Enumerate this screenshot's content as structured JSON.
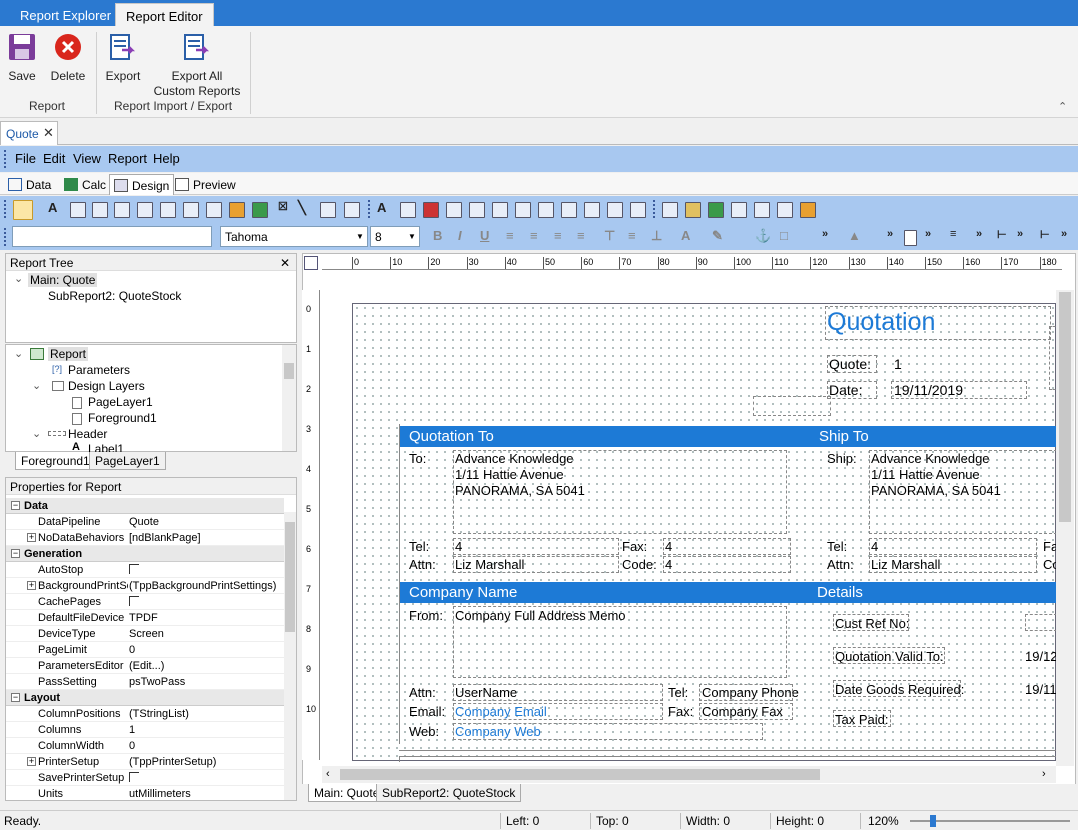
{
  "ribbon": {
    "tabs": [
      "Report Explorer",
      "Report Editor"
    ],
    "save": "Save",
    "delete": "Delete",
    "export": "Export",
    "export_all_1": "Export All",
    "export_all_2": "Custom Reports",
    "group_report": "Report",
    "group_import": "Report Import / Export"
  },
  "doc_tab": "Quote",
  "menu": [
    "File",
    "Edit",
    "View",
    "Report",
    "Help"
  ],
  "view_tabs": [
    "Data",
    "Calc",
    "Design",
    "Preview"
  ],
  "font": {
    "name": "Tahoma",
    "size": "8"
  },
  "report_tree": {
    "title": "Report Tree",
    "main": "Main: Quote",
    "sub": "SubReport2: QuoteStock"
  },
  "tree": {
    "report": "Report",
    "parameters": "Parameters",
    "design_layers": "Design Layers",
    "pagelayer": "PageLayer1",
    "foreground": "Foreground1",
    "header": "Header",
    "label": "Label1"
  },
  "layer_tabs": [
    "Foreground1",
    "PageLayer1"
  ],
  "props": {
    "title": "Properties for Report",
    "cat_data": "Data",
    "cat_generation": "Generation",
    "cat_layout": "Layout",
    "rows": [
      {
        "n": "DataPipeline",
        "v": "Quote"
      },
      {
        "n": "NoDataBehaviors",
        "v": "[ndBlankPage]"
      },
      {
        "n": "AutoStop",
        "v": ""
      },
      {
        "n": "BackgroundPrintSe",
        "v": "(TppBackgroundPrintSettings)"
      },
      {
        "n": "CachePages",
        "v": ""
      },
      {
        "n": "DefaultFileDevice",
        "v": "TPDF"
      },
      {
        "n": "DeviceType",
        "v": "Screen"
      },
      {
        "n": "PageLimit",
        "v": "0"
      },
      {
        "n": "ParametersEditor",
        "v": "(Edit...)"
      },
      {
        "n": "PassSetting",
        "v": "psTwoPass"
      },
      {
        "n": "ColumnPositions",
        "v": "(TStringList)"
      },
      {
        "n": "Columns",
        "v": "1"
      },
      {
        "n": "ColumnWidth",
        "v": "0"
      },
      {
        "n": "PrinterSetup",
        "v": "(TppPrinterSetup)"
      },
      {
        "n": "SavePrinterSetup",
        "v": ""
      },
      {
        "n": "Units",
        "v": "utMillimeters"
      }
    ]
  },
  "ruler": [
    "0",
    "10",
    "20",
    "30",
    "40",
    "50",
    "60",
    "70",
    "80",
    "90",
    "100",
    "110",
    "120",
    "130",
    "140",
    "150",
    "160",
    "170",
    "180"
  ],
  "vruler": [
    "0",
    "1",
    "2",
    "3",
    "4",
    "5",
    "6",
    "7",
    "8",
    "9",
    "10"
  ],
  "design": {
    "quotation": "Quotation",
    "quote_lbl": "Quote:",
    "quote_val": "1",
    "date_lbl": "Date:",
    "date_val": "19/11/2019",
    "quotation_to": "Quotation To",
    "ship_to": "Ship To",
    "to": "To:",
    "to_name": "Advance Knowledge",
    "to_addr1": "1/11 Hattie Avenue",
    "to_addr2": "PANORAMA, SA 5041",
    "ship": "Ship:",
    "ship_name": "Advance Knowledge",
    "ship_addr1": "1/11 Hattie Avenue",
    "ship_addr2": "PANORAMA, SA 5041",
    "tel": "Tel:",
    "tel_val": "4",
    "fax": "Fax:",
    "fax_val": "4",
    "attn": "Attn:",
    "attn_val": "Liz Marshall",
    "code": "Code:",
    "code_val": "4",
    "tel2": "Tel:",
    "tel2_val": "4",
    "fa": "Fa",
    "attn2": "Attn:",
    "attn2_val": "Liz Marshall",
    "co": "Co",
    "company_name": "Company Name",
    "details": "Details",
    "from": "From:",
    "from_val": "Company Full Address Memo",
    "cust_ref": "Cust Ref No:",
    "valid_to": "Quotation Valid To:",
    "valid_val": "19/12",
    "goods_req": "Date Goods Required:",
    "goods_val": "19/11",
    "tax_paid": "Tax Paid:",
    "attn3": "Attn:",
    "username": "UserName",
    "tel3": "Tel:",
    "company_phone": "Company Phone",
    "email": "Email:",
    "company_email": "Company Email",
    "fax3": "Fax:",
    "company_fax": "Company Fax",
    "web": "Web:",
    "company_web": "Company Web"
  },
  "sub_tabs": [
    "Main: Quote",
    "SubReport2: QuoteStock"
  ],
  "status": {
    "ready": "Ready.",
    "left": "Left: 0",
    "top": "Top: 0",
    "width": "Width: 0",
    "height": "Height: 0",
    "zoom": "120%"
  }
}
